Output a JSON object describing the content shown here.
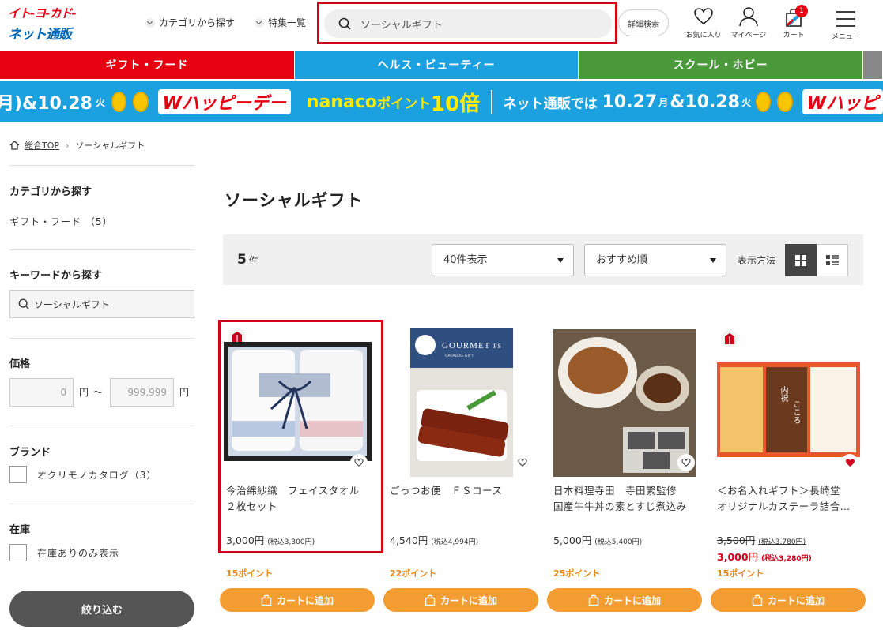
{
  "brand": {
    "line1": "イト-ヨ-カド-",
    "line2": "ネット通販"
  },
  "header": {
    "nav_category": "カテゴリから探す",
    "nav_features": "特集一覧",
    "search_value": "ソーシャルギフト",
    "detail_search": "詳細検索",
    "favorites": "お気に入り",
    "mypage": "マイページ",
    "cart": "カート",
    "cart_count": "1",
    "menu": "メニュー"
  },
  "categories": [
    {
      "label": "ギフト・フード",
      "color": "#e60012"
    },
    {
      "label": "ヘルス・ビューティー",
      "color": "#1ba0e0"
    },
    {
      "label": "スクール・ホビー",
      "color": "#4a9a3c"
    }
  ],
  "banner": {
    "date_left": "月)&10.28",
    "day_left": "火",
    "happy": "Wハッピーデー",
    "nanaco": "nanaco",
    "points": "ポイント",
    "ten": "10倍",
    "netshop": "ネット通販では",
    "date1": "10.27",
    "day1": "月",
    "amp": "&",
    "date2": "10.28",
    "day2": "火",
    "happy2": "Wハッピ"
  },
  "breadcrumb": {
    "home": "総合TOP",
    "current": "ソーシャルギフト"
  },
  "sidebar": {
    "category_heading": "カテゴリから探す",
    "category_item": "ギフト・フード （5）",
    "keyword_heading": "キーワードから探す",
    "keyword_value": "ソーシャルギフト",
    "price_heading": "価格",
    "price_min": "0",
    "price_max": "999,999",
    "yen_tilde": "円 〜",
    "yen": "円",
    "brand_heading": "ブランド",
    "brand_item": "オクリモノカタログ（3）",
    "stock_heading": "在庫",
    "stock_item": "在庫ありのみ表示",
    "filter_button": "絞り込む"
  },
  "main": {
    "title": "ソーシャルギフト",
    "count": "5",
    "count_unit": "件",
    "per_page": "40件表示",
    "sort": "おすすめ順",
    "view_label": "表示方法"
  },
  "products": [
    {
      "name1": "今治綿紗織　フェイスタオル",
      "name2": "２枚セット",
      "price": "3,000円",
      "tax": "(税込3,300円)",
      "points": "15ポイント",
      "cart": "カートに追加"
    },
    {
      "name1": "ごっつお便　ＦＳコース",
      "name2": "",
      "price": "4,540円",
      "tax": "(税込4,994円)",
      "points": "22ポイント",
      "cart": "カートに追加"
    },
    {
      "name1": "日本料理寺田　寺田繁監修",
      "name2": "国産牛牛丼の素とすじ煮込み",
      "price": "5,000円",
      "tax": "(税込5,400円)",
      "points": "25ポイント",
      "cart": "カートに追加"
    },
    {
      "name1": "＜お名入れギフト＞長崎堂",
      "name2": "オリジナルカステーラ詰合…",
      "old_price": "3,500円",
      "old_tax": "(税込3,780円)",
      "price": "3,000円",
      "tax": "(税込3,280円)",
      "points": "15ポイント",
      "cart": "カートに追加"
    }
  ],
  "gourmet_label": "GOURMET",
  "gourmet_fs": "FS",
  "gourmet_sub": "CATALOG GIFT",
  "castella_label1": "内祝",
  "castella_label2": "こころ"
}
